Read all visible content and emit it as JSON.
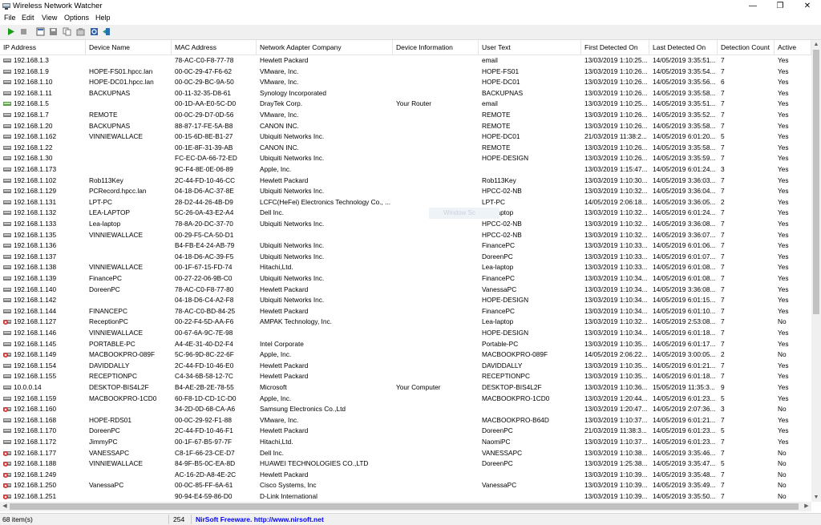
{
  "window": {
    "title": "Wireless Network Watcher",
    "min_glyph": "—",
    "max_glyph": "❐",
    "close_glyph": "✕"
  },
  "menu": [
    "File",
    "Edit",
    "View",
    "Options",
    "Help"
  ],
  "toolbar": {
    "icons": [
      "play-icon",
      "stop-icon",
      "html-report-icon",
      "save-icon",
      "copy-icon",
      "properties-icon",
      "refresh-icon",
      "exit-icon"
    ]
  },
  "columns": [
    "IP Address",
    "Device Name",
    "MAC Address",
    "Network Adapter Company",
    "Device Information",
    "User Text",
    "First Detected On",
    "Last Detected On",
    "Detection Count",
    "Active"
  ],
  "rows": [
    {
      "ip": "192.168.1.3",
      "name": "",
      "mac": "78-AC-C0-F8-77-78",
      "company": "Hewlett Packard",
      "info": "",
      "user": "email",
      "first": "13/03/2019 1:10:25...",
      "last": "14/05/2019 3:35:51...",
      "count": "7",
      "active": "Yes",
      "icon": "pc"
    },
    {
      "ip": "192.168.1.9",
      "name": "HOPE-FS01.hpcc.lan",
      "mac": "00-0C-29-47-F6-62",
      "company": "VMware, Inc.",
      "info": "",
      "user": "HOPE-FS01",
      "first": "13/03/2019 1:10:26...",
      "last": "14/05/2019 3:35:54...",
      "count": "7",
      "active": "Yes",
      "icon": "pc"
    },
    {
      "ip": "192.168.1.10",
      "name": "HOPE-DC01.hpcc.lan",
      "mac": "00-0C-29-BC-9A-50",
      "company": "VMware, Inc.",
      "info": "",
      "user": "HOPE-DC01",
      "first": "13/03/2019 1:10:26...",
      "last": "14/05/2019 3:35:56...",
      "count": "6",
      "active": "Yes",
      "icon": "pc"
    },
    {
      "ip": "192.168.1.11",
      "name": "BACKUPNAS",
      "mac": "00-11-32-35-D8-61",
      "company": "Synology Incorporated",
      "info": "",
      "user": "BACKUPNAS",
      "first": "13/03/2019 1:10:26...",
      "last": "14/05/2019 3:35:58...",
      "count": "7",
      "active": "Yes",
      "icon": "pc"
    },
    {
      "ip": "192.168.1.5",
      "name": "",
      "mac": "00-1D-AA-E0-5C-D0",
      "company": "DrayTek Corp.",
      "info": "Your Router",
      "user": "email",
      "first": "13/03/2019 1:10:25...",
      "last": "14/05/2019 3:35:51...",
      "count": "7",
      "active": "Yes",
      "icon": "router"
    },
    {
      "ip": "192.168.1.7",
      "name": "REMOTE",
      "mac": "00-0C-29-D7-0D-56",
      "company": "VMware, Inc.",
      "info": "",
      "user": "REMOTE",
      "first": "13/03/2019 1:10:26...",
      "last": "14/05/2019 3:35:52...",
      "count": "7",
      "active": "Yes",
      "icon": "pc"
    },
    {
      "ip": "192.168.1.20",
      "name": "BACKUPNAS",
      "mac": "88-87-17-FE-5A-B8",
      "company": "CANON INC.",
      "info": "",
      "user": "REMOTE",
      "first": "13/03/2019 1:10:26...",
      "last": "14/05/2019 3:35:58...",
      "count": "7",
      "active": "Yes",
      "icon": "pc"
    },
    {
      "ip": "192.168.1.162",
      "name": "VINNIEWALLACE",
      "mac": "00-15-6D-8E-B1-27",
      "company": "Ubiquiti Networks Inc.",
      "info": "",
      "user": "HOPE-DC01",
      "first": "21/03/2019 11:38:2...",
      "last": "14/05/2019 6:01:20...",
      "count": "5",
      "active": "Yes",
      "icon": "pc"
    },
    {
      "ip": "192.168.1.22",
      "name": "",
      "mac": "00-1E-8F-31-39-AB",
      "company": "CANON INC.",
      "info": "",
      "user": "REMOTE",
      "first": "13/03/2019 1:10:26...",
      "last": "14/05/2019 3:35:58...",
      "count": "7",
      "active": "Yes",
      "icon": "pc"
    },
    {
      "ip": "192.168.1.30",
      "name": "",
      "mac": "FC-EC-DA-66-72-ED",
      "company": "Ubiquiti Networks Inc.",
      "info": "",
      "user": "HOPE-DESIGN",
      "first": "13/03/2019 1:10:26...",
      "last": "14/05/2019 3:35:59...",
      "count": "7",
      "active": "Yes",
      "icon": "pc"
    },
    {
      "ip": "192.168.1.173",
      "name": "",
      "mac": "9C-F4-8E-0E-06-89",
      "company": "Apple, Inc.",
      "info": "",
      "user": "",
      "first": "13/03/2019 1:15:47...",
      "last": "14/05/2019 6:01:24...",
      "count": "3",
      "active": "Yes",
      "icon": "pc"
    },
    {
      "ip": "192.168.1.102",
      "name": "Rob113Key",
      "mac": "2C-44-FD-10-46-CC",
      "company": "Hewlett Packard",
      "info": "",
      "user": "Rob113Key",
      "first": "13/03/2019 1:10:30...",
      "last": "14/05/2019 3:36:03...",
      "count": "7",
      "active": "Yes",
      "icon": "pc"
    },
    {
      "ip": "192.168.1.129",
      "name": "PCRecord.hpcc.lan",
      "mac": "04-18-D6-AC-37-8E",
      "company": "Ubiquiti Networks Inc.",
      "info": "",
      "user": "HPCC-02-NB",
      "first": "13/03/2019 1:10:32...",
      "last": "14/05/2019 3:36:04...",
      "count": "7",
      "active": "Yes",
      "icon": "pc"
    },
    {
      "ip": "192.168.1.131",
      "name": "LPT-PC",
      "mac": "28-D2-44-26-4B-D9",
      "company": "LCFC(HeFei) Electronics Technology Co., ...",
      "info": "",
      "user": "LPT-PC",
      "first": "14/05/2019 2:06:18...",
      "last": "14/05/2019 3:36:05...",
      "count": "2",
      "active": "Yes",
      "icon": "pc"
    },
    {
      "ip": "192.168.1.132",
      "name": "LEA-LAPTOP",
      "mac": "5C-26-0A-43-E2-A4",
      "company": "Dell Inc.",
      "info": "",
      "user": "Lea-laptop",
      "first": "13/03/2019 1:10:32...",
      "last": "14/05/2019 6:01:24...",
      "count": "7",
      "active": "Yes",
      "icon": "pc"
    },
    {
      "ip": "192.168.1.133",
      "name": "Lea-laptop",
      "mac": "78-8A-20-DC-37-70",
      "company": "Ubiquiti Networks Inc.",
      "info": "",
      "user": "HPCC-02-NB",
      "first": "13/03/2019 1:10:32...",
      "last": "14/05/2019 3:36:08...",
      "count": "7",
      "active": "Yes",
      "icon": "pc"
    },
    {
      "ip": "192.168.1.135",
      "name": "VINNIEWALLACE",
      "mac": "00-29-F5-CA-50-D1",
      "company": "",
      "info": "",
      "user": "HPCC-02-NB",
      "first": "13/03/2019 1:10:32...",
      "last": "14/05/2019 3:36:07...",
      "count": "7",
      "active": "Yes",
      "icon": "pc"
    },
    {
      "ip": "192.168.1.136",
      "name": "",
      "mac": "B4-FB-E4-24-AB-79",
      "company": "Ubiquiti Networks Inc.",
      "info": "",
      "user": "FinancePC",
      "first": "13/03/2019 1:10:33...",
      "last": "14/05/2019 6:01:06...",
      "count": "7",
      "active": "Yes",
      "icon": "pc"
    },
    {
      "ip": "192.168.1.137",
      "name": "",
      "mac": "04-18-D6-AC-39-F5",
      "company": "Ubiquiti Networks Inc.",
      "info": "",
      "user": "DoreenPC",
      "first": "13/03/2019 1:10:33...",
      "last": "14/05/2019 6:01:07...",
      "count": "7",
      "active": "Yes",
      "icon": "pc"
    },
    {
      "ip": "192.168.1.138",
      "name": "VINNIEWALLACE",
      "mac": "00-1F-67-15-FD-74",
      "company": "Hitachi,Ltd.",
      "info": "",
      "user": "Lea-laptop",
      "first": "13/03/2019 1:10:33...",
      "last": "14/05/2019 6:01:08...",
      "count": "7",
      "active": "Yes",
      "icon": "pc"
    },
    {
      "ip": "192.168.1.139",
      "name": "FinancePC",
      "mac": "00-27-22-06-9B-C0",
      "company": "Ubiquiti Networks Inc.",
      "info": "",
      "user": "FinancePC",
      "first": "13/03/2019 1:10:34...",
      "last": "14/05/2019 6:01:08...",
      "count": "7",
      "active": "Yes",
      "icon": "pc"
    },
    {
      "ip": "192.168.1.140",
      "name": "DoreenPC",
      "mac": "78-AC-C0-F8-77-80",
      "company": "Hewlett Packard",
      "info": "",
      "user": "VanessaPC",
      "first": "13/03/2019 1:10:34...",
      "last": "14/05/2019 3:36:08...",
      "count": "7",
      "active": "Yes",
      "icon": "pc"
    },
    {
      "ip": "192.168.1.142",
      "name": "",
      "mac": "04-18-D6-C4-A2-F8",
      "company": "Ubiquiti Networks Inc.",
      "info": "",
      "user": "HOPE-DESIGN",
      "first": "13/03/2019 1:10:34...",
      "last": "14/05/2019 6:01:15...",
      "count": "7",
      "active": "Yes",
      "icon": "pc"
    },
    {
      "ip": "192.168.1.144",
      "name": "FINANCEPC",
      "mac": "78-AC-C0-BD-84-25",
      "company": "Hewlett Packard",
      "info": "",
      "user": "FinancePC",
      "first": "13/03/2019 1:10:34...",
      "last": "14/05/2019 6:01:10...",
      "count": "7",
      "active": "Yes",
      "icon": "pc"
    },
    {
      "ip": "192.168.1.127",
      "name": "ReceptionPC",
      "mac": "00-22-F4-5D-AA-F6",
      "company": "AMPAK Technology, Inc.",
      "info": "",
      "user": "Lea-laptop",
      "first": "13/03/2019 1:10:32...",
      "last": "14/05/2019 2:53:08...",
      "count": "7",
      "active": "No",
      "icon": "inactive"
    },
    {
      "ip": "192.168.1.146",
      "name": "VINNIEWALLACE",
      "mac": "00-67-6A-9C-7E-98",
      "company": "",
      "info": "",
      "user": "HOPE-DESIGN",
      "first": "13/03/2019 1:10:34...",
      "last": "14/05/2019 6:01:18...",
      "count": "7",
      "active": "Yes",
      "icon": "pc"
    },
    {
      "ip": "192.168.1.145",
      "name": "PORTABLE-PC",
      "mac": "A4-4E-31-40-D2-F4",
      "company": "Intel Corporate",
      "info": "",
      "user": "Portable-PC",
      "first": "13/03/2019 1:10:35...",
      "last": "14/05/2019 6:01:17...",
      "count": "7",
      "active": "Yes",
      "icon": "pc"
    },
    {
      "ip": "192.168.1.149",
      "name": "MACBOOKPRO-089F",
      "mac": "5C-96-9D-8C-22-6F",
      "company": "Apple, Inc.",
      "info": "",
      "user": "MACBOOKPRO-089F",
      "first": "14/05/2019 2:06:22...",
      "last": "14/05/2019 3:00:05...",
      "count": "2",
      "active": "No",
      "icon": "inactive"
    },
    {
      "ip": "192.168.1.154",
      "name": "DAVIDDALLY",
      "mac": "2C-44-FD-10-46-E0",
      "company": "Hewlett Packard",
      "info": "",
      "user": "DAVIDDALLY",
      "first": "13/03/2019 1:10:35...",
      "last": "14/05/2019 6:01:21...",
      "count": "7",
      "active": "Yes",
      "icon": "pc"
    },
    {
      "ip": "192.168.1.155",
      "name": "RECEPTIONPC",
      "mac": "C4-34-6B-58-12-7C",
      "company": "Hewlett Packard",
      "info": "",
      "user": "RECEPTIONPC",
      "first": "13/03/2019 1:10:35...",
      "last": "14/05/2019 6:01:18...",
      "count": "7",
      "active": "Yes",
      "icon": "pc"
    },
    {
      "ip": "10.0.0.14",
      "name": "DESKTOP-BIS4L2F",
      "mac": "B4-AE-2B-2E-78-55",
      "company": "Microsoft",
      "info": "Your Computer",
      "user": "DESKTOP-BIS4L2F",
      "first": "13/03/2019 1:10:36...",
      "last": "15/05/2019 11:35:3...",
      "count": "9",
      "active": "Yes",
      "icon": "pc"
    },
    {
      "ip": "192.168.1.159",
      "name": "MACBOOKPRO-1CD0",
      "mac": "60-F8-1D-CD-1C-D0",
      "company": "Apple, Inc.",
      "info": "",
      "user": "MACBOOKPRO-1CD0",
      "first": "13/03/2019 1:20:44...",
      "last": "14/05/2019 6:01:23...",
      "count": "5",
      "active": "Yes",
      "icon": "pc"
    },
    {
      "ip": "192.168.1.160",
      "name": "",
      "mac": "34-2D-0D-68-CA-A6",
      "company": "Samsung Electronics Co.,Ltd",
      "info": "",
      "user": "",
      "first": "13/03/2019 1:20:47...",
      "last": "14/05/2019 2:07:36...",
      "count": "3",
      "active": "No",
      "icon": "inactive"
    },
    {
      "ip": "192.168.1.168",
      "name": "HOPE-RDS01",
      "mac": "00-0C-29-92-F1-88",
      "company": "VMware, Inc.",
      "info": "",
      "user": "MACBOOKPRO-B64D",
      "first": "13/03/2019 1:10:37...",
      "last": "14/05/2019 6:01:21...",
      "count": "7",
      "active": "Yes",
      "icon": "pc"
    },
    {
      "ip": "192.168.1.170",
      "name": "DoreenPC",
      "mac": "2C-44-FD-10-46-F1",
      "company": "Hewlett Packard",
      "info": "",
      "user": "DoreenPC",
      "first": "21/03/2019 11:38:3...",
      "last": "14/05/2019 6:01:23...",
      "count": "5",
      "active": "Yes",
      "icon": "pc"
    },
    {
      "ip": "192.168.1.172",
      "name": "JimmyPC",
      "mac": "00-1F-67-B5-97-7F",
      "company": "Hitachi,Ltd.",
      "info": "",
      "user": "NaomiPC",
      "first": "13/03/2019 1:10:37...",
      "last": "14/05/2019 6:01:23...",
      "count": "7",
      "active": "Yes",
      "icon": "pc"
    },
    {
      "ip": "192.168.1.177",
      "name": "VANESSAPC",
      "mac": "C8-1F-66-23-CE-D7",
      "company": "Dell Inc.",
      "info": "",
      "user": "VANESSAPC",
      "first": "13/03/2019 1:10:38...",
      "last": "14/05/2019 3:35:46...",
      "count": "7",
      "active": "No",
      "icon": "inactive"
    },
    {
      "ip": "192.168.1.188",
      "name": "VINNIEWALLACE",
      "mac": "84-9F-B5-0C-EA-8D",
      "company": "HUAWEI TECHNOLOGIES CO.,LTD",
      "info": "",
      "user": "DoreenPC",
      "first": "13/03/2019 1:25:38...",
      "last": "14/05/2019 3:35:47...",
      "count": "5",
      "active": "No",
      "icon": "inactive"
    },
    {
      "ip": "192.168.1.249",
      "name": "",
      "mac": "AC-16-2D-A8-4E-2C",
      "company": "Hewlett Packard",
      "info": "",
      "user": "",
      "first": "13/03/2019 1:10:39...",
      "last": "14/05/2019 3:35:48...",
      "count": "7",
      "active": "No",
      "icon": "inactive"
    },
    {
      "ip": "192.168.1.250",
      "name": "VanessaPC",
      "mac": "00-0C-85-FF-6A-61",
      "company": "Cisco Systems, Inc",
      "info": "",
      "user": "VanessaPC",
      "first": "13/03/2019 1:10:39...",
      "last": "14/05/2019 3:35:49...",
      "count": "7",
      "active": "No",
      "icon": "inactive"
    },
    {
      "ip": "192.168.1.251",
      "name": "",
      "mac": "90-94-E4-59-86-D0",
      "company": "D-Link International",
      "info": "",
      "user": "",
      "first": "13/03/2019 1:10:39...",
      "last": "14/05/2019 3:35:50...",
      "count": "7",
      "active": "No",
      "icon": "inactive"
    }
  ],
  "status": {
    "items": "68 item(s)",
    "count": "254",
    "freeware": "NirSoft Freeware.  http://www.nirsoft.net"
  },
  "watermark": "Window Sc",
  "colors": {
    "link": "#0000ff",
    "inactive": "#d62828",
    "play": "#1a9e1a"
  }
}
